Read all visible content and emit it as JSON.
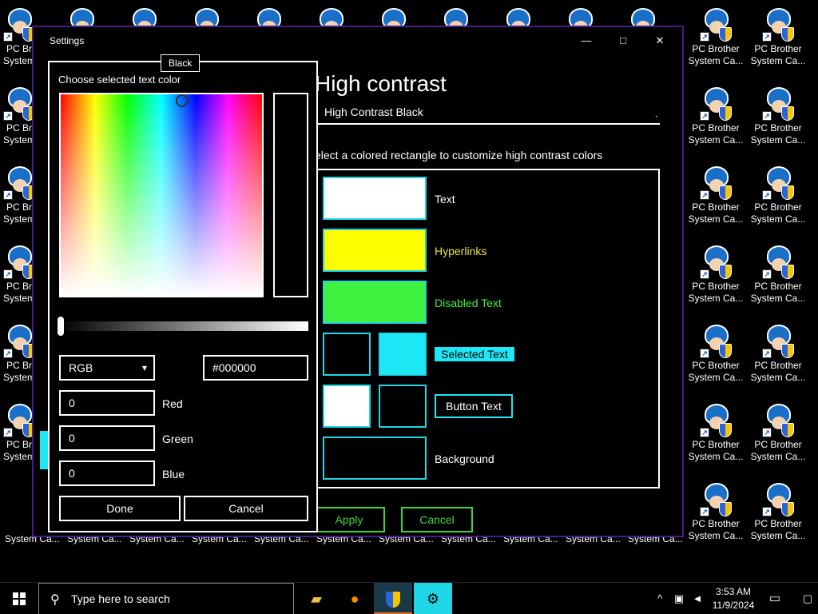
{
  "desktop": {
    "icon_label_line1": "PC Brother",
    "icon_label_line2": "System Ca...",
    "left_label_line1": "PC Br",
    "left_label_line2": "System",
    "bottom_label": "System Ca..."
  },
  "settings": {
    "window_title": "Settings",
    "minimize": "—",
    "maximize": "□",
    "close": "✕",
    "page_title": "High contrast",
    "theme_value": "High Contrast Black",
    "theme_chevron": "ˎ",
    "instruction": "elect a colored rectangle to customize high contrast colors",
    "swatches": {
      "text": "Text",
      "hyperlinks": "Hyperlinks",
      "disabled_text": "Disabled Text",
      "selected_text": "Selected Text",
      "button_text": "Button Text",
      "background": "Background"
    },
    "colors": {
      "text": "#ffffff",
      "hyperlinks": "#ffff00",
      "disabled_text": "#3ff23f",
      "selected_bg": "#1ee8f5",
      "accent": "#1ed6e6"
    },
    "apply": "Apply",
    "cancel": "Cancel"
  },
  "picker": {
    "title": "Choose selected text color",
    "tooltip": "Black",
    "mode": "RGB",
    "hex": "#000000",
    "red_value": "0",
    "red_label": "Red",
    "green_value": "0",
    "green_label": "Green",
    "blue_value": "0",
    "blue_label": "Blue",
    "done": "Done",
    "cancel": "Cancel"
  },
  "taskbar": {
    "search_placeholder": "Type here to search",
    "time": "3:53 AM",
    "date": "11/9/2024"
  }
}
